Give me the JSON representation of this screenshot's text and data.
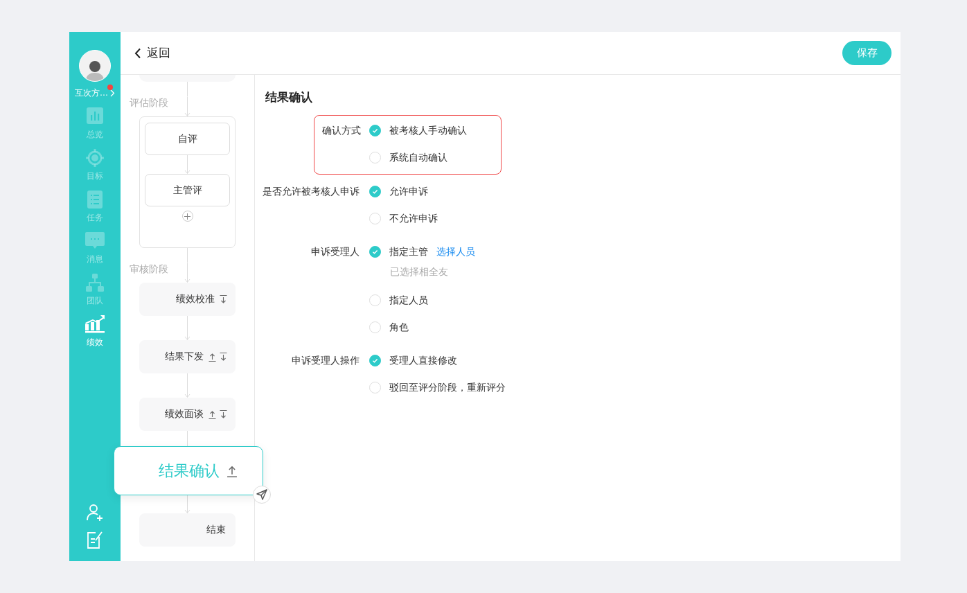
{
  "sidebar": {
    "user": {
      "name": "互次方…",
      "unread": true
    },
    "nav": [
      {
        "label": "总览",
        "selected": false
      },
      {
        "label": "目标",
        "selected": false
      },
      {
        "label": "任务",
        "selected": false
      },
      {
        "label": "消息",
        "selected": false
      },
      {
        "label": "团队",
        "selected": false
      },
      {
        "label": "绩效",
        "selected": true
      }
    ]
  },
  "header": {
    "back_label": "返回",
    "save_label": "保存"
  },
  "flow": [
    {
      "kind": "stub"
    },
    {
      "kind": "stage",
      "label": "评估阶段"
    },
    {
      "kind": "group",
      "nodes": [
        {
          "label": "自评"
        },
        {
          "label": "主管评"
        }
      ]
    },
    {
      "kind": "stage",
      "label": "审核阶段"
    },
    {
      "kind": "node",
      "label": "绩效校准",
      "move_up": false,
      "move_down": true
    },
    {
      "kind": "node",
      "label": "结果下发",
      "move_up": true,
      "move_down": true
    },
    {
      "kind": "node",
      "label": "绩效面谈",
      "move_up": true,
      "move_down": true
    },
    {
      "kind": "dragging",
      "label": "结果确认",
      "move_up": true,
      "move_down": false
    },
    {
      "kind": "node",
      "label": "结束",
      "move_up": false,
      "move_down": false
    }
  ],
  "form": {
    "title": "结果确认",
    "sections": [
      {
        "label": "确认方式",
        "highlighted": true,
        "options": [
          {
            "label": "被考核人手动确认",
            "selected": true
          },
          {
            "label": "系统自动确认",
            "selected": false
          }
        ]
      },
      {
        "label": "是否允许被考核人申诉",
        "highlighted": false,
        "options": [
          {
            "label": "允许申诉",
            "selected": true
          },
          {
            "label": "不允许申诉",
            "selected": false
          }
        ]
      },
      {
        "label": "申诉受理人",
        "highlighted": false,
        "options": [
          {
            "label": "指定主管",
            "selected": true,
            "link": "选择人员",
            "note": "已选择相全友"
          },
          {
            "label": "指定人员",
            "selected": false
          },
          {
            "label": "角色",
            "selected": false
          }
        ]
      },
      {
        "label": "申诉受理人操作",
        "highlighted": false,
        "options": [
          {
            "label": "受理人直接修改",
            "selected": true
          },
          {
            "label": "驳回至评分阶段，重新评分",
            "selected": false
          }
        ]
      }
    ]
  }
}
